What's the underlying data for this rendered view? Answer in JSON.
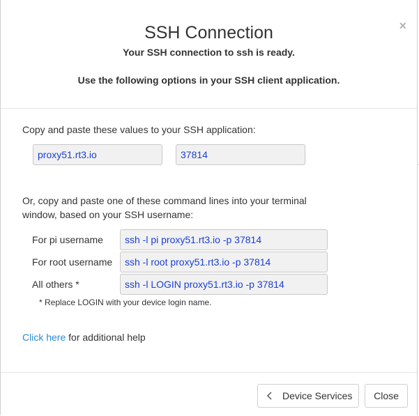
{
  "dialog": {
    "title": "SSH Connection",
    "subtitle": "Your SSH connection to ssh is ready.",
    "instructions": "Use the following options in your SSH client application.",
    "close_symbol": "×"
  },
  "values_section": {
    "intro": "Copy and paste these values to your SSH application:",
    "host": "proxy51.rt3.io",
    "port": "37814"
  },
  "commands_section": {
    "intro_line1": "Or, copy and paste one of these command lines into your terminal",
    "intro_line2": "window, based on your SSH username:",
    "rows": [
      {
        "label": "For pi username",
        "command": "ssh -l pi proxy51.rt3.io -p 37814"
      },
      {
        "label": "For root username",
        "command": "ssh -l root proxy51.rt3.io -p 37814"
      },
      {
        "label": "All others *",
        "command": "ssh -l LOGIN proxy51.rt3.io -p 37814"
      }
    ],
    "note": "* Replace LOGIN with your device login name."
  },
  "help": {
    "link_text": "Click here",
    "suffix": " for additional help"
  },
  "footer": {
    "device_services_label": "Device Services",
    "device_services_icon": "chevron-left-icon",
    "close_label": "Close"
  },
  "colors": {
    "field_text": "#1a3fd6",
    "link": "#2a8ad4",
    "field_bg": "#f1f1f1"
  }
}
